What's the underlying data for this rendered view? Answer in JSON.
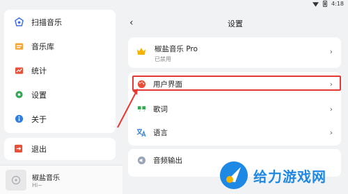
{
  "status": {
    "time": "4:18"
  },
  "nav": {
    "items": [
      {
        "label": "扫描音乐",
        "icon": "scan-music-icon"
      },
      {
        "label": "音乐库",
        "icon": "music-library-icon"
      },
      {
        "label": "统计",
        "icon": "stats-icon"
      },
      {
        "label": "设置",
        "icon": "gear-icon"
      },
      {
        "label": "关于",
        "icon": "info-icon"
      }
    ],
    "logout": "退出"
  },
  "player": {
    "title": "椒盐音乐",
    "subtitle": "Hi~"
  },
  "settings": {
    "title": "设置",
    "pro": {
      "title": "椒盐音乐 Pro",
      "status": "已禁用"
    },
    "items": [
      {
        "label": "用户界面",
        "icon": "palette-icon"
      },
      {
        "label": "歌词",
        "icon": "quote-icon"
      },
      {
        "label": "语言",
        "icon": "translate-icon"
      },
      {
        "label": "音频输出",
        "icon": "audio-output-icon"
      }
    ]
  },
  "colors": {
    "accent": "#1e88e5",
    "highlight": "#e53935",
    "pro_gold": "#f5b301"
  },
  "watermark": {
    "text": "给力游戏网"
  }
}
